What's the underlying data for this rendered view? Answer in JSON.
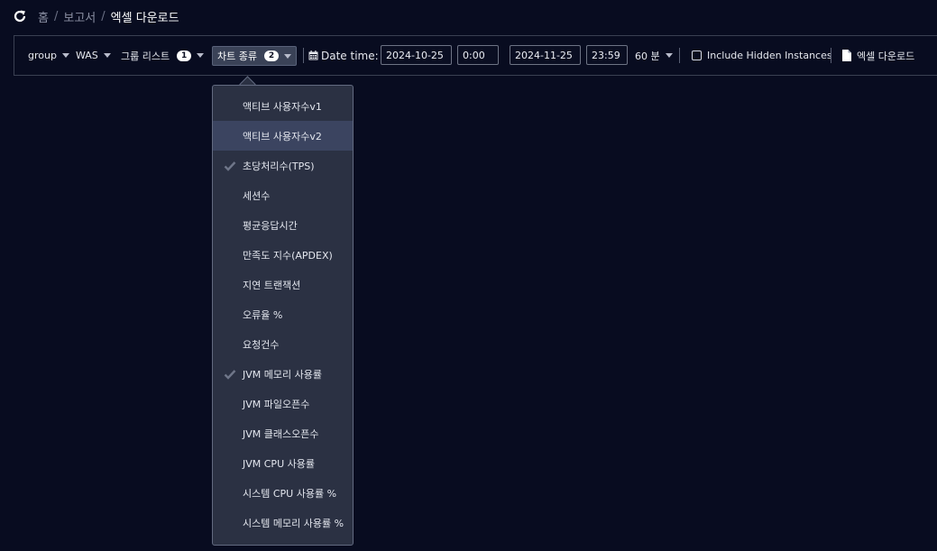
{
  "breadcrumb": {
    "home": "홈",
    "parent": "보고서",
    "current": "엑셀 다운로드",
    "separator": "/"
  },
  "toolbar": {
    "group_label": "group",
    "was_label": "WAS",
    "group_list_label": "그룹 리스트",
    "group_list_count": "1",
    "chart_type_label": "차트 종류",
    "chart_type_count": "2",
    "date_time_label": "Date time:",
    "start_date": "2024-10-25",
    "start_time": "0:00",
    "end_date": "2024-11-25",
    "end_time": "23:59",
    "interval": "60 분",
    "include_hidden_label": "Include Hidden Instances",
    "excel_download_label": "엑셀 다운로드"
  },
  "chart_type_options": [
    {
      "label": "액티브 사용자수v1",
      "checked": false,
      "hover": false
    },
    {
      "label": "액티브 사용자수v2",
      "checked": false,
      "hover": true
    },
    {
      "label": "초당처리수(TPS)",
      "checked": true,
      "hover": false
    },
    {
      "label": "세션수",
      "checked": false,
      "hover": false
    },
    {
      "label": "평균응답시간",
      "checked": false,
      "hover": false
    },
    {
      "label": "만족도 지수(APDEX)",
      "checked": false,
      "hover": false
    },
    {
      "label": "지연 트랜잭션",
      "checked": false,
      "hover": false
    },
    {
      "label": "오류율 %",
      "checked": false,
      "hover": false
    },
    {
      "label": "요청건수",
      "checked": false,
      "hover": false
    },
    {
      "label": "JVM 메모리 사용률",
      "checked": true,
      "hover": false
    },
    {
      "label": "JVM 파일오픈수",
      "checked": false,
      "hover": false
    },
    {
      "label": "JVM 클래스오픈수",
      "checked": false,
      "hover": false
    },
    {
      "label": "JVM CPU 사용률",
      "checked": false,
      "hover": false
    },
    {
      "label": "시스템 CPU 사용률 %",
      "checked": false,
      "hover": false
    },
    {
      "label": "시스템 메모리 사용률 %",
      "checked": false,
      "hover": false
    }
  ],
  "colors": {
    "background": "#080c20",
    "dropdown_bg": "#2b3143",
    "hover_bg": "#3b4460",
    "check_color": "#6f7689"
  }
}
